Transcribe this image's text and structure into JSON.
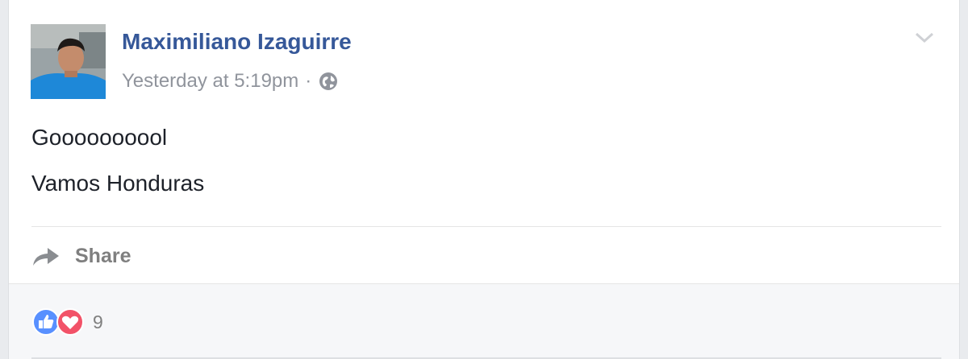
{
  "post": {
    "author": "Maximiliano Izaguirre",
    "timestamp": "Yesterday at 5:19pm",
    "separator": "·",
    "privacy_icon": "globe-icon",
    "lines": [
      "Goooooooool",
      "Vamos Honduras"
    ]
  },
  "actions": {
    "share_label": "Share",
    "share_icon": "share-arrow-icon"
  },
  "reactions": {
    "types": [
      "like",
      "love"
    ],
    "count": "9"
  },
  "colors": {
    "author": "#365899",
    "meta": "#90949c",
    "like": "#5890ff",
    "love": "#f25268"
  }
}
